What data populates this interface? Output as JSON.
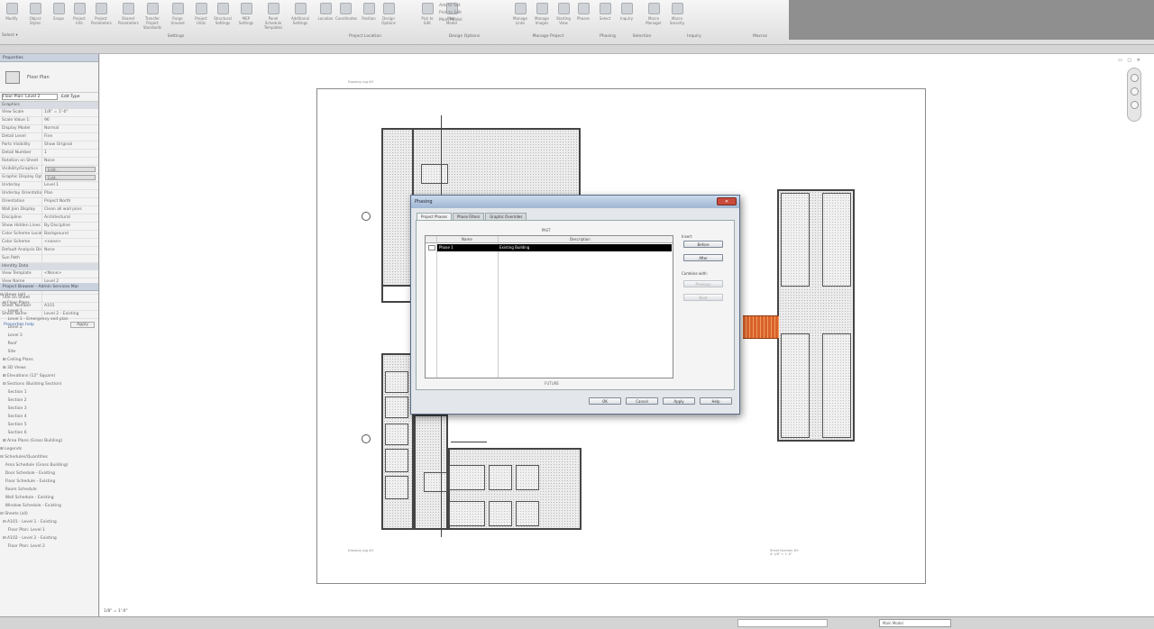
{
  "ribbon": {
    "buttons": [
      "Modify",
      "Object Styles",
      "Snaps",
      "Project Info",
      "Project Parameters",
      "Shared Parameters",
      "Transfer Project Standards",
      "Purge Unused",
      "Project Units",
      "Structural Settings",
      "MEP Settings",
      "Panel Schedule Templates",
      "Additional Settings",
      "Location",
      "Coordinates",
      "Position",
      "Design Options",
      "Pick to Edit",
      "Main Model",
      "Manage Links",
      "Manage Images",
      "Starting View",
      "Phases",
      "Select",
      "Inquiry",
      "Macro Manager",
      "Macro Security"
    ],
    "panels": [
      "Settings",
      "Project Location",
      "Design Options",
      "Manage Project",
      "Phasing",
      "Selection",
      "Inquiry",
      "Macros"
    ],
    "stack_items": [
      "Add to Set",
      "Pick to Edit",
      "Main Model"
    ],
    "select_label": "Select ▾"
  },
  "properties": {
    "title": "Properties",
    "type_name": "Floor Plan",
    "selector": "Floor Plan: Level 2",
    "edit_type": "Edit Type",
    "category_graphics": "Graphics",
    "category_identity": "Identity Data",
    "rows": [
      {
        "k": "View Scale",
        "v": "1/8\" = 1'-0\""
      },
      {
        "k": "Scale Value 1:",
        "v": "96"
      },
      {
        "k": "Display Model",
        "v": "Normal"
      },
      {
        "k": "Detail Level",
        "v": "Fine"
      },
      {
        "k": "Parts Visibility",
        "v": "Show Original"
      },
      {
        "k": "Detail Number",
        "v": "1"
      },
      {
        "k": "Rotation on Sheet",
        "v": "None"
      },
      {
        "k": "Visibility/Graphics",
        "v": "Edit..."
      },
      {
        "k": "Graphic Display Options",
        "v": "Edit..."
      },
      {
        "k": "Underlay",
        "v": "Level 1"
      },
      {
        "k": "Underlay Orientation",
        "v": "Plan"
      },
      {
        "k": "Orientation",
        "v": "Project North"
      },
      {
        "k": "Wall Join Display",
        "v": "Clean all wall joins"
      },
      {
        "k": "Discipline",
        "v": "Architectural"
      },
      {
        "k": "Show Hidden Lines",
        "v": "By Discipline"
      },
      {
        "k": "Color Scheme Location",
        "v": "Background"
      },
      {
        "k": "Color Scheme",
        "v": "<none>"
      },
      {
        "k": "Default Analysis Display",
        "v": "None"
      },
      {
        "k": "Sun Path",
        "v": ""
      }
    ],
    "identity_rows": [
      {
        "k": "View Template",
        "v": "<None>"
      },
      {
        "k": "View Name",
        "v": "Level 2"
      },
      {
        "k": "Dependency",
        "v": "Independent"
      },
      {
        "k": "Title on Sheet",
        "v": ""
      },
      {
        "k": "Sheet Number",
        "v": "A101"
      },
      {
        "k": "Sheet Name",
        "v": "Level 2 - Existing"
      }
    ],
    "help_link": "Properties help",
    "apply": "Apply"
  },
  "browser": {
    "title": "Project Browser - Admin Services Mar",
    "items": [
      "⊟ Views (all)",
      "  ⊟ Floor Plans",
      "      Level 1",
      "      Level 1 - Emergency exit plan",
      "      Level 2",
      "      Level 3",
      "      Roof",
      "      Site",
      "  ⊞ Ceiling Plans",
      "  ⊞ 3D Views",
      "  ⊞ Elevations (12\" Square)",
      "  ⊟ Sections (Building Section)",
      "      Section 1",
      "      Section 2",
      "      Section 3",
      "      Section 4",
      "      Section 5",
      "      Section 6",
      "  ⊞ Area Plans (Gross Building)",
      "⊞ Legends",
      "⊟ Schedules/Quantities",
      "    Area Schedule (Gross Building)",
      "    Door Schedule - Existing",
      "    Floor Schedule - Existing",
      "    Room Schedule",
      "    Wall Schedule - Existing",
      "    Window Schedule - Existing",
      "⊟ Sheets (all)",
      "  ⊟ A101 - Level 1 - Existing",
      "      Floor Plan: Level 1",
      "  ⊟ A102 - Level 2 - Existing",
      "      Floor Plan: Level 2"
    ]
  },
  "sheet": {
    "note_top": "Drawing Log #5",
    "note_bottom_left": "Drawing Log #5",
    "note_bottom_right": "Sheet Number #5\n# 1/8\" = 1'-0\""
  },
  "dialog": {
    "title": "Phasing",
    "close": "✕",
    "tabs": [
      "Project Phases",
      "Phase Filters",
      "Graphic Overrides"
    ],
    "caption": "PAST",
    "columns": [
      "Name",
      "Description"
    ],
    "row": {
      "num": "1",
      "name": "Phase 1",
      "description": "Existing Building"
    },
    "insert_label": "Insert",
    "combine_label": "Combine with:",
    "buttons": {
      "before": "Before",
      "after": "After",
      "previous": "Previous",
      "next": "Next"
    },
    "close_label": "FUTURE",
    "footer": {
      "ok": "OK",
      "cancel": "Cancel",
      "apply": "Apply",
      "help": "Help"
    }
  },
  "view_controls": "1/8\" = 1'-0\"",
  "status": {
    "model": "Main Model"
  }
}
